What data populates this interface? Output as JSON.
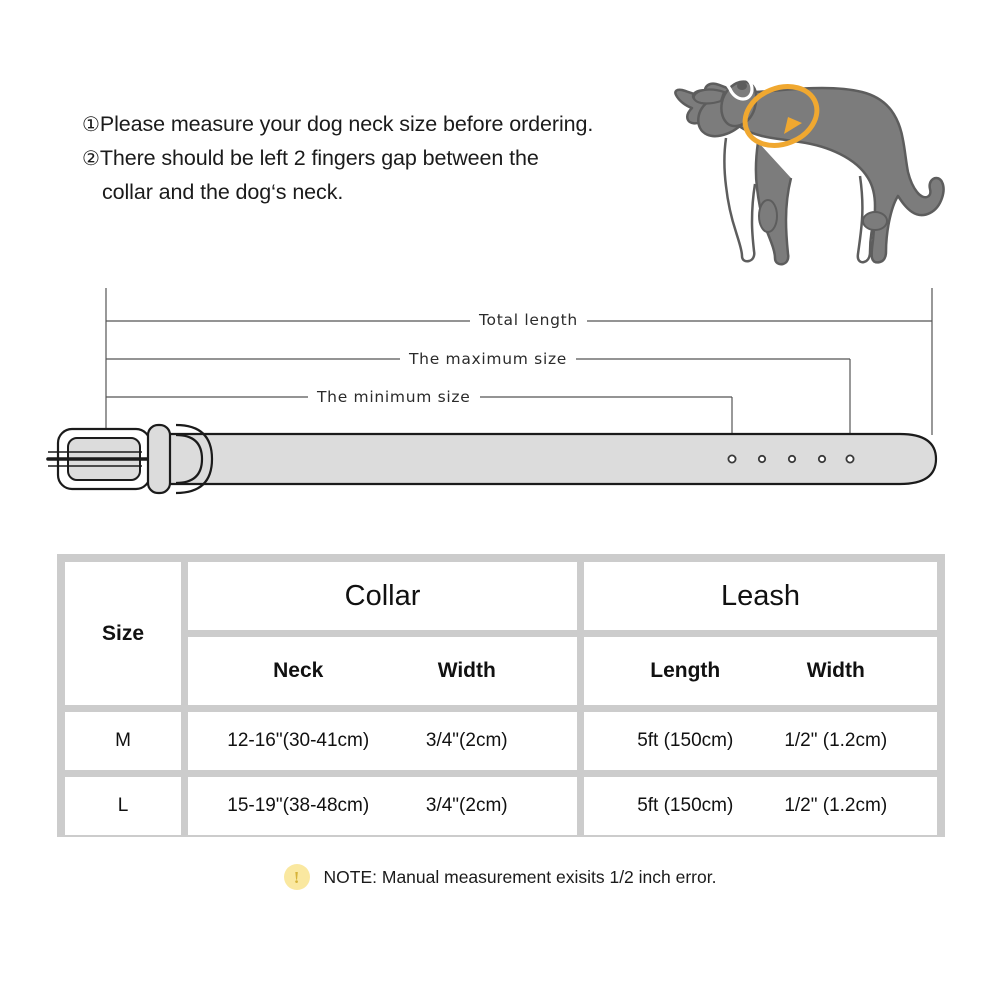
{
  "instructions": {
    "items": [
      {
        "marker": "①",
        "text": "Please measure your dog neck size before ordering."
      },
      {
        "marker": "②",
        "text": "There should be left 2 fingers gap between the",
        "continuation": "collar and the dog‘s neck."
      }
    ]
  },
  "illustration": {
    "dog_alt": "dog-silhouette",
    "measure_loop_alt": "neck-measure-loop-arrow",
    "dog_color": "#7c7c7c",
    "dog_outline": "#5d5d5d",
    "loop_color": "#f0a830"
  },
  "belt_diagram": {
    "belt_color": "#dcdcdc",
    "belt_outline": "#1b1b1b",
    "dimension_lines": [
      {
        "id": "total",
        "label": "Total length"
      },
      {
        "id": "max",
        "label": "The maximum size"
      },
      {
        "id": "min",
        "label": "The minimum size"
      }
    ],
    "hole_count": 5
  },
  "table": {
    "border_color": "#cccccc",
    "size_header": "Size",
    "groups": [
      {
        "name": "Collar"
      },
      {
        "name": "Leash"
      }
    ],
    "subheaders": {
      "collar": [
        "Neck",
        "Width"
      ],
      "leash": [
        "Length",
        "Width"
      ]
    },
    "rows": [
      {
        "size": "M",
        "collar_neck": "12-16\"(30-41cm)",
        "collar_width": "3/4\"(2cm)",
        "leash_length": "5ft (150cm)",
        "leash_width": "1/2\" (1.2cm)"
      },
      {
        "size": "L",
        "collar_neck": "15-19\"(38-48cm)",
        "collar_width": "3/4\"(2cm)",
        "leash_length": "5ft (150cm)",
        "leash_width": "1/2\" (1.2cm)"
      }
    ]
  },
  "note": {
    "icon": "exclamation-icon",
    "icon_glyph": "!",
    "icon_bg": "#fae8a0",
    "text": "NOTE: Manual measurement exisits 1/2 inch error."
  }
}
